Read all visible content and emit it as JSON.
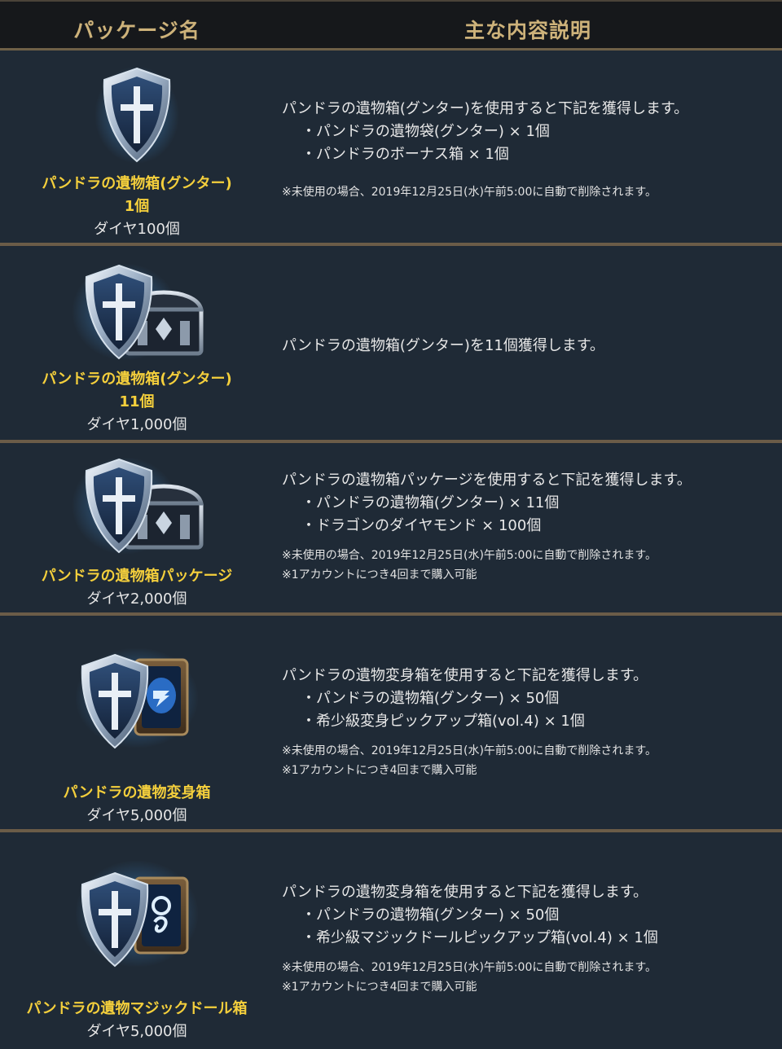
{
  "header": {
    "col_name": "パッケージ名",
    "col_desc": "主な内容説明"
  },
  "colors": {
    "gold": "#f4cf3c",
    "header_text": "#cdb27a",
    "row_bg": "#1f2a36",
    "separator": "#6b5c48"
  },
  "rows": [
    {
      "icon": "shield-icon",
      "name_lines": [
        "パンドラの遺物箱(グンター)",
        "1個"
      ],
      "price": "ダイヤ100個",
      "desc": "パンドラの遺物箱(グンター)を使用すると下記を獲得します。",
      "items": [
        "・パンドラの遺物袋(グンター) × 1個",
        "・パンドラのボーナス箱 × 1個"
      ],
      "notes": [
        "※未使用の場合、2019年12月25日(水)午前5:00に自動で削除されます。"
      ]
    },
    {
      "icon": "shield-chest-icon",
      "name_lines": [
        "パンドラの遺物箱(グンター)",
        "11個"
      ],
      "price": "ダイヤ1,000個",
      "desc": "パンドラの遺物箱(グンター)を11個獲得します。",
      "items": [],
      "notes": []
    },
    {
      "icon": "shield-chest-icon",
      "name_lines": [
        "パンドラの遺物箱パッケージ"
      ],
      "price": "ダイヤ2,000個",
      "desc": "パンドラの遺物箱パッケージを使用すると下記を獲得します。",
      "items": [
        "・パンドラの遺物箱(グンター) × 11個",
        "・ドラゴンのダイヤモンド × 100個"
      ],
      "notes": [
        "※未使用の場合、2019年12月25日(水)午前5:00に自動で削除されます。",
        "※1アカウントにつき4回まで購入可能"
      ]
    },
    {
      "icon": "shield-card-icon",
      "name_lines": [
        "パンドラの遺物変身箱"
      ],
      "price": "ダイヤ5,000個",
      "desc": "パンドラの遺物変身箱を使用すると下記を獲得します。",
      "items": [
        "・パンドラの遺物箱(グンター) × 50個",
        "・希少級変身ピックアップ箱(vol.4) × 1個"
      ],
      "notes": [
        "※未使用の場合、2019年12月25日(水)午前5:00に自動で削除されます。",
        "※1アカウントにつき4回まで購入可能"
      ]
    },
    {
      "icon": "shield-doll-card-icon",
      "name_lines": [
        "パンドラの遺物マジックドール箱"
      ],
      "price": "ダイヤ5,000個",
      "desc": "パンドラの遺物変身箱を使用すると下記を獲得します。",
      "items": [
        "・パンドラの遺物箱(グンター) × 50個",
        "・希少級マジックドールピックアップ箱(vol.4) × 1個"
      ],
      "notes": [
        "※未使用の場合、2019年12月25日(水)午前5:00に自動で削除されます。",
        "※1アカウントにつき4回まで購入可能"
      ]
    }
  ]
}
